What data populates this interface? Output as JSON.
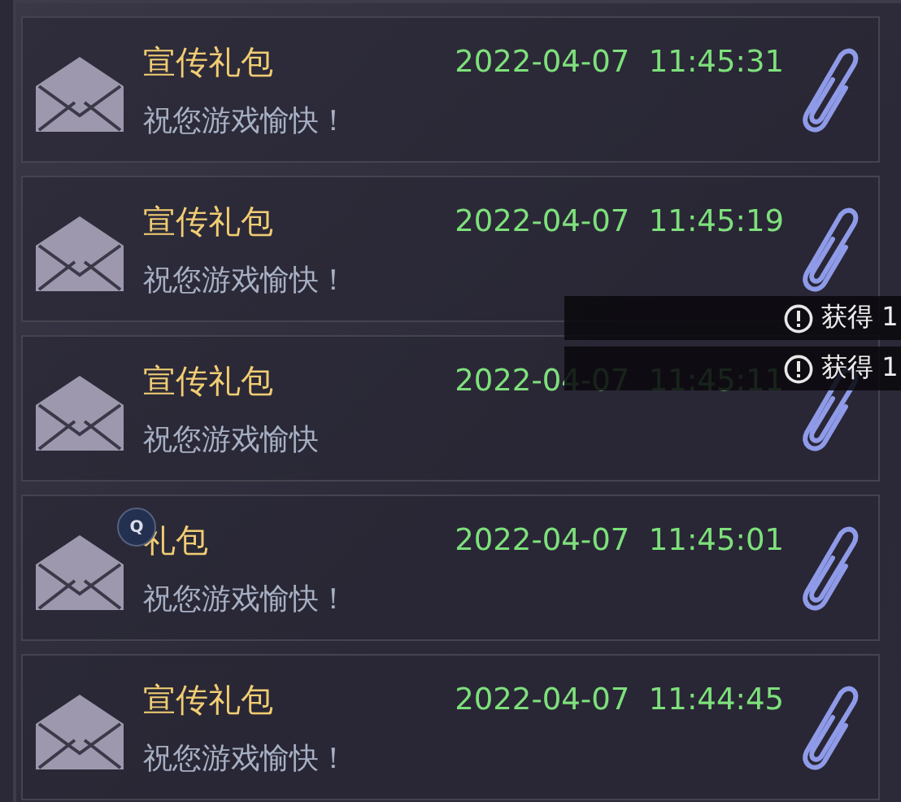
{
  "mails": [
    {
      "title": "宣传礼包",
      "message": "祝您游戏愉快！",
      "date": "2022-04-07",
      "time": "11:45:31",
      "attachment": true
    },
    {
      "title": "宣传礼包",
      "message": "祝您游戏愉快！",
      "date": "2022-04-07",
      "time": "11:45:19",
      "attachment": true
    },
    {
      "title": "宣传礼包",
      "message": "祝您游戏愉快",
      "date": "2022-04-07",
      "time": "11:45:11",
      "attachment": true
    },
    {
      "title": "礼包",
      "message": "祝您游戏愉快！",
      "date": "2022-04-07",
      "time": "11:45:01",
      "attachment": true,
      "badge": "Q"
    },
    {
      "title": "宣传礼包",
      "message": "祝您游戏愉快！",
      "date": "2022-04-07",
      "time": "11:44:45",
      "attachment": true
    }
  ],
  "toasts": [
    {
      "text": "获得 1"
    },
    {
      "text": "获得 1"
    }
  ]
}
